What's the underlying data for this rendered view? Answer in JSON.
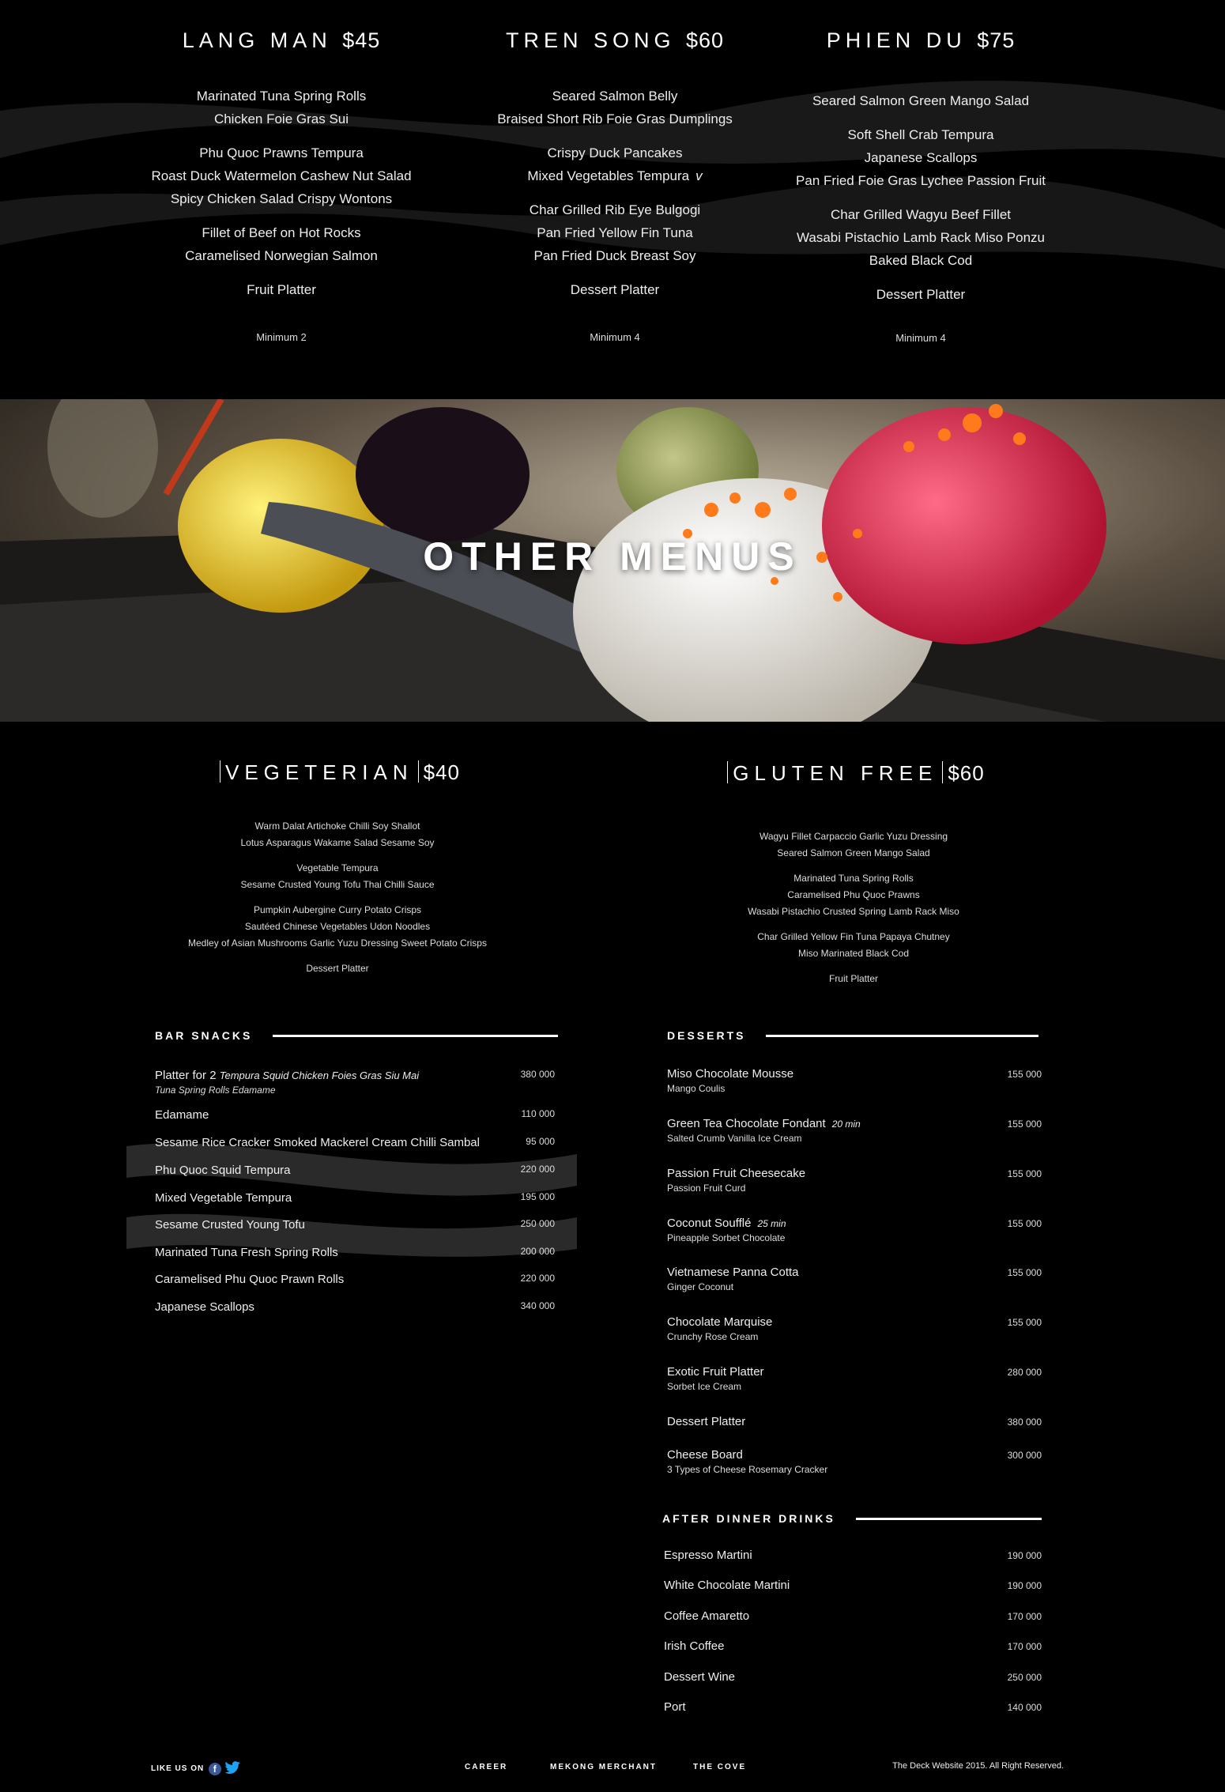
{
  "set_menus": [
    {
      "name": "LANG MAN",
      "price": "$45",
      "groups": [
        [
          "Marinated Tuna Spring Rolls",
          "Chicken Foie Gras Sui"
        ],
        [
          "Phu Quoc Prawns Tempura",
          "Roast Duck Watermelon Cashew Nut Salad",
          "Spicy Chicken Salad Crispy Wontons"
        ],
        [
          "Fillet of Beef on Hot Rocks",
          "Caramelised Norwegian Salmon"
        ]
      ],
      "dessert": "Fruit Platter",
      "minimum": "Minimum 2"
    },
    {
      "name": "TREN SONG",
      "price": "$60",
      "groups": [
        [
          "Seared Salmon Belly",
          "Braised Short Rib Foie Gras Dumplings"
        ],
        [
          "Crispy Duck Pancakes",
          "Mixed Vegetables Tempura"
        ],
        [
          "Char Grilled Rib Eye Bulgogi",
          "Pan Fried Yellow Fin Tuna",
          "Pan Fried Duck Breast Soy"
        ]
      ],
      "veg_mark": "v",
      "dessert": "Dessert Platter",
      "minimum": "Minimum 4"
    },
    {
      "name": "PHIEN DU",
      "price": "$75",
      "groups": [
        [
          "Seared Salmon Green Mango Salad"
        ],
        [
          "Soft Shell Crab Tempura",
          "Japanese Scallops",
          "Pan Fried Foie Gras Lychee Passion Fruit"
        ],
        [
          "Char Grilled Wagyu Beef Fillet",
          "Wasabi Pistachio Lamb Rack Miso Ponzu",
          "Baked Black Cod"
        ]
      ],
      "dessert": "Dessert Platter",
      "minimum": "Minimum 4"
    }
  ],
  "hero": {
    "title": "OTHER MENUS"
  },
  "other_menus": [
    {
      "name": "VEGETERIAN",
      "price": "$40",
      "groups": [
        [
          "Warm Dalat Artichoke Chilli Soy Shallot",
          "Lotus Asparagus Wakame Salad Sesame Soy"
        ],
        [
          "Vegetable Tempura",
          "Sesame Crusted Young Tofu Thai Chilli Sauce"
        ],
        [
          "Pumpkin Aubergine Curry Potato Crisps",
          "Sautéed Chinese Vegetables Udon Noodles",
          "Medley of Asian Mushrooms Garlic Yuzu Dressing Sweet Potato Crisps"
        ],
        [
          "Dessert Platter"
        ]
      ]
    },
    {
      "name": "GLUTEN FREE",
      "price": "$60",
      "groups": [
        [
          "Wagyu Fillet Carpaccio Garlic Yuzu Dressing",
          "Seared Salmon Green Mango Salad"
        ],
        [
          "Marinated Tuna Spring Rolls",
          "Caramelised Phu Quoc Prawns",
          "Wasabi Pistachio Crusted Spring Lamb Rack Miso"
        ],
        [
          "Char Grilled Yellow Fin Tuna Papaya Chutney",
          "Miso Marinated Black Cod"
        ],
        [
          "Fruit Platter"
        ]
      ]
    }
  ],
  "bar_snacks": {
    "heading": "BAR SNACKS",
    "items": [
      {
        "name": "Platter for 2",
        "detail": "Tempura Squid Chicken Foies Gras Siu Mai",
        "detail2": "Tuna Spring Rolls Edamame",
        "price": "380 000"
      },
      {
        "name": "Edamame",
        "price": "110 000"
      },
      {
        "name": "Sesame Rice Cracker Smoked Mackerel Cream Chilli Sambal",
        "price": "95 000"
      },
      {
        "name": "Phu Quoc Squid Tempura",
        "price": "220 000"
      },
      {
        "name": "Mixed Vegetable Tempura",
        "price": "195 000"
      },
      {
        "name": "Sesame Crusted Young Tofu",
        "price": "250 000"
      },
      {
        "name": "Marinated Tuna Fresh Spring Rolls",
        "price": "200 000"
      },
      {
        "name": "Caramelised Phu Quoc Prawn Rolls",
        "price": "220 000"
      },
      {
        "name": "Japanese Scallops",
        "price": "340 000"
      }
    ]
  },
  "desserts": {
    "heading": "DESSERTS",
    "items": [
      {
        "name": "Miso Chocolate Mousse",
        "sub": "Mango Coulis",
        "price": "155 000"
      },
      {
        "name": "Green Tea Chocolate Fondant",
        "tag": "20 min",
        "sub": "Salted Crumb Vanilla Ice Cream",
        "price": "155 000"
      },
      {
        "name": "Passion Fruit Cheesecake",
        "sub": "Passion Fruit Curd",
        "price": "155 000"
      },
      {
        "name": "Coconut Soufflé",
        "tag": "25 min",
        "sub": "Pineapple Sorbet Chocolate",
        "price": "155 000"
      },
      {
        "name": "Vietnamese Panna Cotta",
        "sub": "Ginger Coconut",
        "price": "155 000"
      },
      {
        "name": "Chocolate Marquise",
        "sub": "Crunchy Rose Cream",
        "price": "155 000"
      },
      {
        "name": "Exotic Fruit Platter",
        "sub": "Sorbet Ice Cream",
        "price": "280 000"
      },
      {
        "name": "Dessert Platter",
        "price": "380 000"
      },
      {
        "name": "Cheese Board",
        "sub": "3 Types of Cheese Rosemary Cracker",
        "price": "300 000"
      }
    ]
  },
  "drinks": {
    "heading": "AFTER DINNER DRINKS",
    "items": [
      {
        "name": "Espresso Martini",
        "price": "190 000"
      },
      {
        "name": "White Chocolate Martini",
        "price": "190 000"
      },
      {
        "name": "Coffee Amaretto",
        "price": "170 000"
      },
      {
        "name": "Irish Coffee",
        "price": "170 000"
      },
      {
        "name": "Dessert Wine",
        "price": "250 000"
      },
      {
        "name": "Port",
        "price": "140 000"
      }
    ]
  },
  "footer": {
    "like_label": "LIKE US ON",
    "nav": [
      "CAREER",
      "MEKONG MERCHANT",
      "THE COVE"
    ],
    "copyright": "The Deck Website 2015. All Right Reserved."
  }
}
